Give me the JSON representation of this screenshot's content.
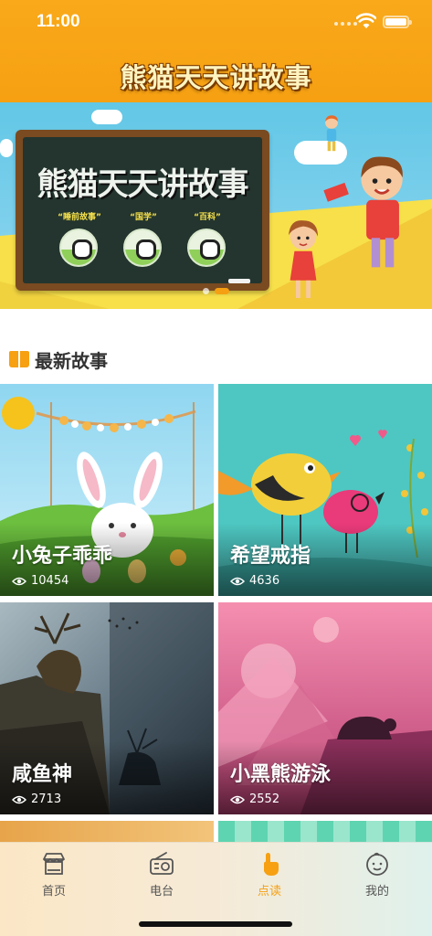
{
  "status_bar": {
    "time": "11:00"
  },
  "header": {
    "title": "熊猫天天讲故事"
  },
  "banner": {
    "board_title": "熊猫天天讲故事",
    "categories": [
      "“睡前故事”",
      "“国学”",
      "“百科”"
    ],
    "page_count": 2,
    "active_page": 2
  },
  "section": {
    "title": "最新故事",
    "icon": "book-icon"
  },
  "stories": [
    {
      "title": "小兔子乖乖",
      "views": "10454"
    },
    {
      "title": "希望戒指",
      "views": "4636"
    },
    {
      "title": "咸鱼神",
      "views": "2713"
    },
    {
      "title": "小黑熊游泳",
      "views": "2552"
    }
  ],
  "tabbar": {
    "items": [
      {
        "label": "首页",
        "icon": "shop-icon"
      },
      {
        "label": "电台",
        "icon": "radio-icon"
      },
      {
        "label": "点读",
        "icon": "pointer-hand-icon"
      },
      {
        "label": "我的",
        "icon": "baby-face-icon"
      }
    ],
    "active_index": 2
  },
  "colors": {
    "accent": "#f6a012",
    "header": "#f9a91a"
  }
}
